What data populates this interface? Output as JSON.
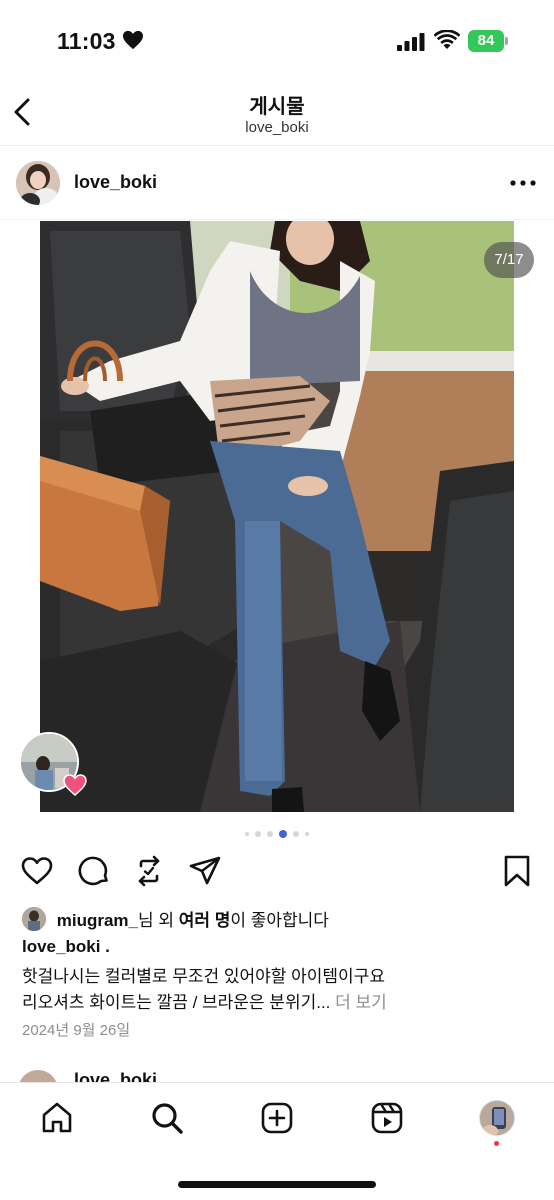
{
  "status_bar": {
    "time": "11:03",
    "battery": "84"
  },
  "header": {
    "title": "게시물",
    "subtitle": "love_boki"
  },
  "post": {
    "username": "love_boki",
    "image_counter": "7/17",
    "likes": {
      "user": "miugram_",
      "middle": "님 외 ",
      "bold": "여러 명",
      "end": "이 좋아합니다"
    },
    "caption_user": "love_boki .",
    "caption_line1": "핫걸나시는 컬러별로 무조건 있어야할 아이템이구요",
    "caption_line2": "리오셔츠 화이트는 깔끔 / 브라운은 분위기...",
    "more_label": " 더 보기",
    "date": "2024년 9월 26일"
  },
  "next_post": {
    "username": "love_boki"
  },
  "icons": {
    "back": "chevron-left-icon",
    "more": "more-horizontal-icon",
    "like": "heart-icon",
    "comment": "comment-icon",
    "repost": "repost-icon",
    "share": "send-icon",
    "save": "bookmark-icon",
    "nav": [
      "home-icon",
      "search-icon",
      "create-icon",
      "reels-icon",
      "profile-avatar"
    ]
  },
  "colors": {
    "accent": "#3f63d9",
    "battery": "#35c759",
    "muted": "#8e8e8e",
    "notification": "#ff3040"
  }
}
